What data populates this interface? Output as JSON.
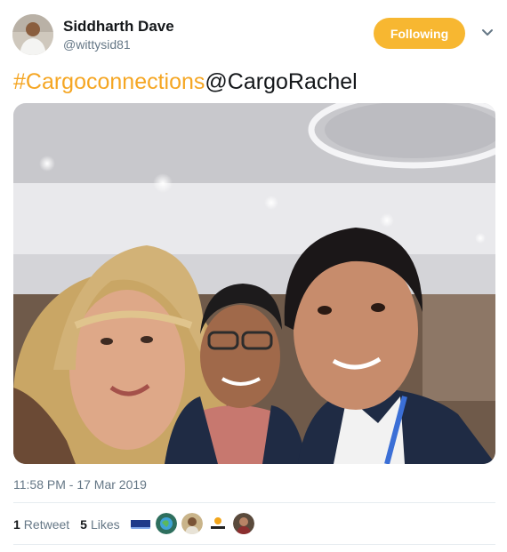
{
  "author": {
    "name": "Siddharth Dave",
    "handle": "@wittysid81",
    "avatar_icon": "profile-photo-man-white-shirt"
  },
  "follow_button": {
    "label": "Following",
    "color": "#f7b731"
  },
  "caret_icon": "chevron-down-icon",
  "tweet": {
    "hashtag": "#Cargoconnections",
    "mention": "@CargoRachel",
    "hashtag_color": "#f5a623"
  },
  "photo": {
    "description_icon": "selfie-photo-three-people"
  },
  "timestamp": "11:58 PM - 17 Mar 2019",
  "stats": {
    "retweets_count": "1",
    "retweets_label": "Retweet",
    "likes_count": "5",
    "likes_label": "Likes"
  },
  "likers": [
    {
      "icon": "brand-logo-avatar"
    },
    {
      "icon": "globe-avatar"
    },
    {
      "icon": "person-avatar"
    },
    {
      "icon": "cargo-logo-avatar"
    },
    {
      "icon": "person-avatar-2"
    }
  ]
}
